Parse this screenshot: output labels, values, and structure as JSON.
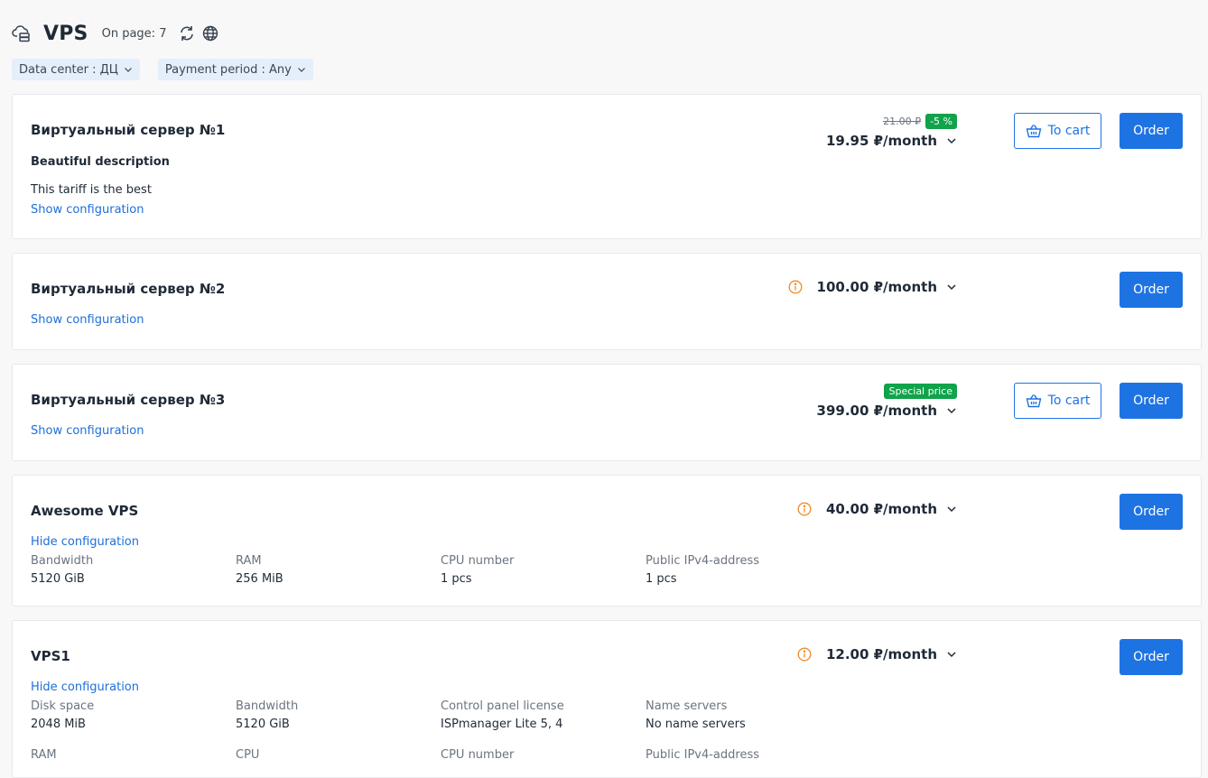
{
  "header": {
    "title": "VPS",
    "on_page_label": "On page: 7",
    "title_icon": "cloud-server-icon",
    "refresh_icon": "refresh-icon",
    "language_icon": "globe-icon"
  },
  "filters": [
    {
      "label": "Data center : ДЦ"
    },
    {
      "label": "Payment period : Any"
    }
  ],
  "colors": {
    "accent": "#1e73e3",
    "link": "#1e6fd9",
    "badge": "#10a34a",
    "warning_icon": "#f08a24"
  },
  "tariffs": [
    {
      "name": "Виртуальный сервер №1",
      "description_title": "Beautiful description",
      "description": "This tariff is the best",
      "config_toggle": "Show configuration",
      "old_price": "21.00 ₽",
      "badge": "-5 %",
      "price": "19.95 ₽/month",
      "cart_label": "To cart",
      "order_label": "Order"
    },
    {
      "name": "Виртуальный сервер №2",
      "config_toggle": "Show configuration",
      "price": "100.00 ₽/month",
      "order_label": "Order"
    },
    {
      "name": "Виртуальный сервер №3",
      "config_toggle": "Show configuration",
      "badge": "Special price",
      "price": "399.00 ₽/month",
      "cart_label": "To cart",
      "order_label": "Order"
    },
    {
      "name": "Awesome VPS",
      "config_toggle": "Hide configuration",
      "price": "40.00 ₽/month",
      "order_label": "Order",
      "config": [
        {
          "label": "Bandwidth",
          "value": "5120 GiB"
        },
        {
          "label": "RAM",
          "value": "256 MiB"
        },
        {
          "label": "CPU number",
          "value": "1 pcs"
        },
        {
          "label": "Public IPv4-address",
          "value": "1 pcs"
        }
      ]
    },
    {
      "name": "VPS1",
      "config_toggle": "Hide configuration",
      "price": "12.00 ₽/month",
      "order_label": "Order",
      "config": [
        {
          "label": "Disk space",
          "value": "2048 MiB"
        },
        {
          "label": "Bandwidth",
          "value": "5120 GiB"
        },
        {
          "label": "Control panel license",
          "value": "ISPmanager Lite 5, 4"
        },
        {
          "label": "Name servers",
          "value": "No name servers"
        },
        {
          "label": "RAM"
        },
        {
          "label": "CPU"
        },
        {
          "label": "CPU number"
        },
        {
          "label": "Public IPv4-address"
        }
      ]
    }
  ]
}
